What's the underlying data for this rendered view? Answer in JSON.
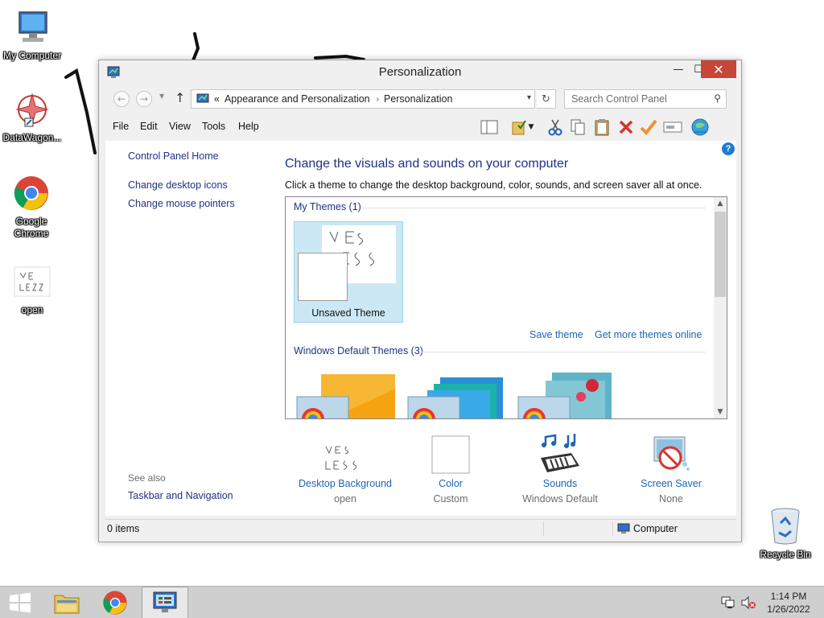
{
  "desktop": {
    "icons": [
      {
        "label": "My Computer"
      },
      {
        "label": "DataWagon..."
      },
      {
        "label": "Google Chrome"
      },
      {
        "label": "open"
      },
      {
        "label": "Recycle Bin"
      }
    ]
  },
  "window": {
    "title": "Personalization",
    "buttons": {
      "minimize": "—",
      "maximize": "☐",
      "close": "✕"
    },
    "address": {
      "prefix": "«",
      "crumbs": [
        "Appearance and Personalization",
        "Personalization"
      ],
      "separator": "›"
    },
    "search": {
      "placeholder": "Search Control Panel"
    },
    "menu": [
      "File",
      "Edit",
      "View",
      "Tools",
      "Help"
    ],
    "help_label": "?",
    "left_nav": {
      "home": "Control Panel Home",
      "links": [
        "Change desktop icons",
        "Change mouse pointers"
      ],
      "see_also_label": "See also",
      "see_also_links": [
        "Taskbar and Navigation"
      ]
    },
    "main": {
      "heading": "Change the visuals and sounds on your computer",
      "subtext": "Click a theme to change the desktop background, color, sounds, and screen saver all at once.",
      "my_themes_header": "My Themes (1)",
      "unsaved_theme": "Unsaved Theme",
      "wallpaper_scribble": "USE LESS",
      "save_theme": "Save theme",
      "get_more": "Get more themes online",
      "default_themes_header": "Windows Default Themes (3)"
    },
    "bottom_items": [
      {
        "name": "Desktop Background",
        "value": "open"
      },
      {
        "name": "Color",
        "value": "Custom"
      },
      {
        "name": "Sounds",
        "value": "Windows Default"
      },
      {
        "name": "Screen Saver",
        "value": "None"
      }
    ],
    "status": {
      "items": "0 items",
      "location": "Computer"
    }
  },
  "taskbar": {
    "clock_time": "1:14 PM",
    "clock_date": "1/26/2022"
  },
  "colors": {
    "link": "#1e64b4",
    "heading": "#1e3287",
    "close_button": "#c7463a",
    "selection": "#cce8f4"
  }
}
